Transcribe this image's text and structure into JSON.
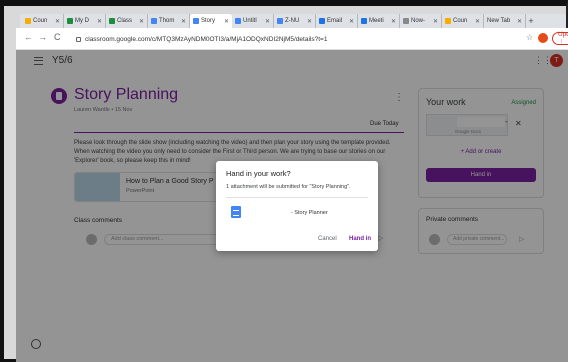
{
  "browser": {
    "tabs": [
      {
        "label": "Coun",
        "color": "#f9ab00"
      },
      {
        "label": "My D",
        "color": "#1e8e3e"
      },
      {
        "label": "Class",
        "color": "#1e8e3e"
      },
      {
        "label": "Thom",
        "color": "#4285f4"
      },
      {
        "label": "Story",
        "color": "#4285f4",
        "active": true
      },
      {
        "label": "Untitl",
        "color": "#4285f4"
      },
      {
        "label": "Z-NU",
        "color": "#4285f4"
      },
      {
        "label": "Email",
        "color": "#1a73e8"
      },
      {
        "label": "Meeti",
        "color": "#1a73e8"
      },
      {
        "label": "Now-",
        "color": "#888888"
      },
      {
        "label": "Coun",
        "color": "#f9ab00"
      },
      {
        "label": "New Tab",
        "color": ""
      }
    ],
    "new_tab": "+",
    "back": "←",
    "forward": "→",
    "reload": "C",
    "url": "classroom.google.com/c/MTQ3MzAyNDM0OTI3/a/MjA1ODQxNDI2NjM5/details?t=1",
    "star": "☆",
    "update_label": "Update ⋮"
  },
  "appbar": {
    "class_name": "Y5/6",
    "apps_icon": "⋮⋮⋮",
    "avatar_letter": "T"
  },
  "assignment": {
    "title": "Story Planning",
    "meta": "Lauren Wardle • 15 Nov",
    "kebab": "⋮",
    "due": "Due Today",
    "instructions": "Please look through the slide show (including watching the video) and then plan your story using the template provided. When watching the video you only need to consider the First or Third person. We are trying to base our stories on our 'Explorer' book, so please keep this in mind!",
    "attachment_title": "How to Plan a Good Story P",
    "attachment_type": "PowerPoint",
    "class_comments_label": "Class comments",
    "class_comment_placeholder": "Add class comment..."
  },
  "your_work": {
    "title": "Your work",
    "status": "Assigned",
    "file_type": "Google Docs",
    "add_label": "+ Add or create",
    "hand_in_label": "Hand in"
  },
  "private_comments": {
    "title": "Private comments",
    "placeholder": "Add private comment..."
  },
  "dialog": {
    "title": "Hand in your work?",
    "message": "1 attachment will be submitted for \"Story Planning\".",
    "file_name": "- Story Planner",
    "cancel_label": "Cancel",
    "hand_in_label": "Hand in"
  },
  "icons": {
    "close": "✕",
    "send": "▷"
  },
  "colors": {
    "accent": "#7b1fa2",
    "assigned": "#1e8e3e",
    "update": "#d93025"
  }
}
